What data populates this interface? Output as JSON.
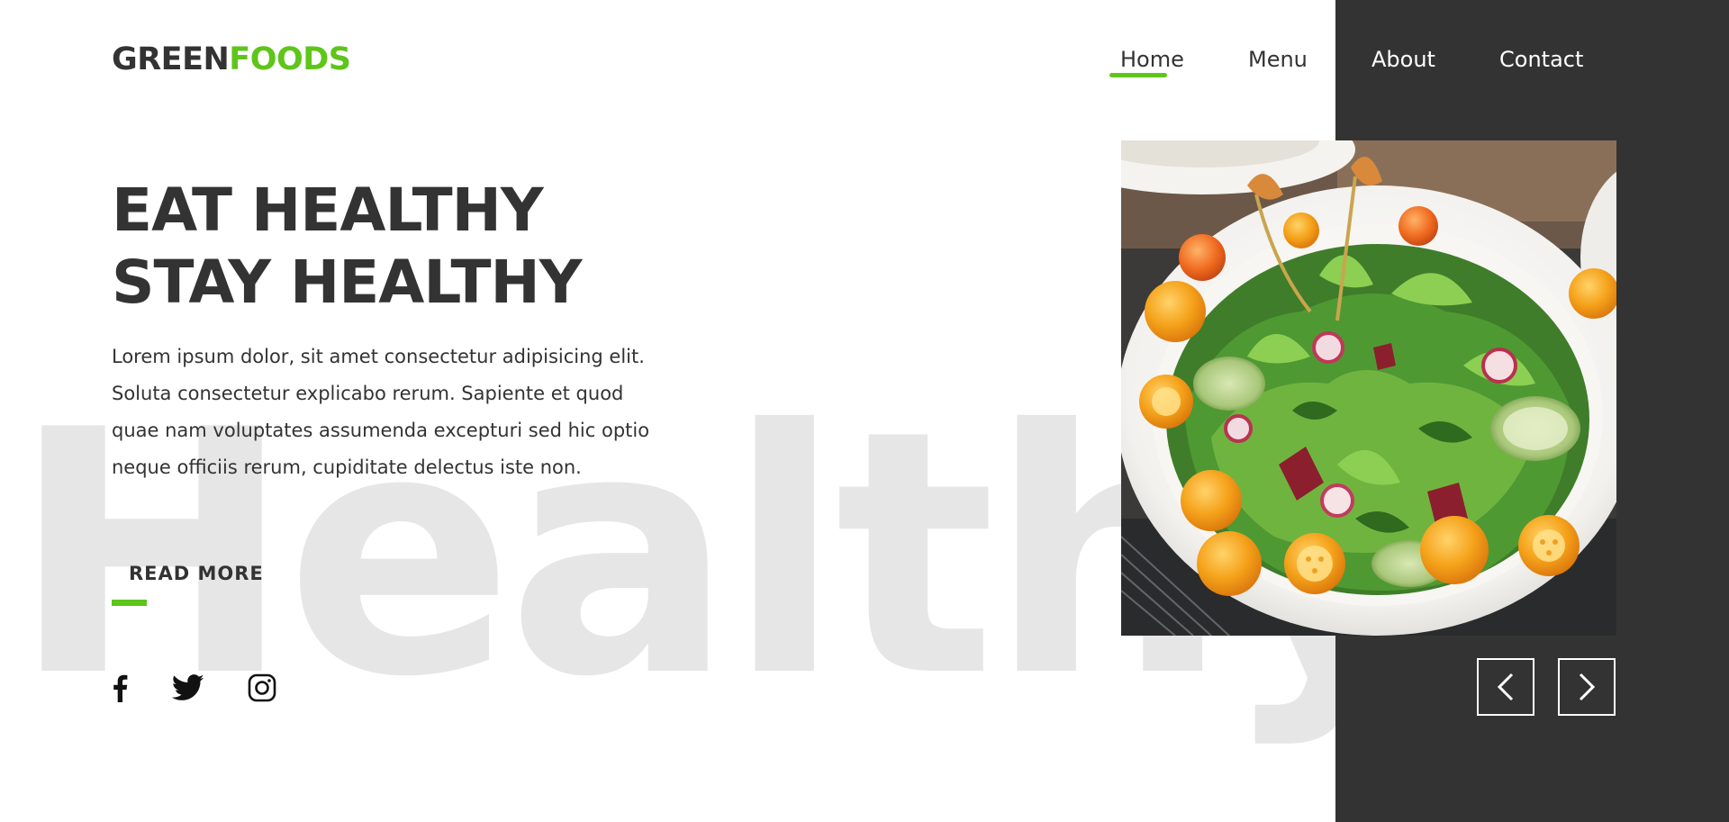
{
  "brand": {
    "name_dark": "GREEN",
    "name_green": "FOODS"
  },
  "nav": {
    "items": [
      {
        "label": "Home",
        "active": true
      },
      {
        "label": "Menu",
        "active": false
      },
      {
        "label": "About",
        "active": false
      },
      {
        "label": "Contact",
        "active": false
      }
    ]
  },
  "hero": {
    "headline_line1": "EAT HEALTHY",
    "headline_line2": "STAY HEALTHY",
    "body": "Lorem ipsum dolor, sit amet consectetur adipisicing elit. Soluta consectetur explicabo rerum. Sapiente et quod quae nam voluptates assumenda excepturi sed hic optio neque officiis rerum, cupiditate delectus iste non.",
    "cta_label": "READ MORE",
    "background_word": "Healthy",
    "image_icon": "salad-bowl-photo"
  },
  "social": {
    "icons": [
      "facebook-icon",
      "twitter-icon",
      "instagram-icon"
    ]
  },
  "slider": {
    "prev_icon": "chevron-left-icon",
    "next_icon": "chevron-right-icon"
  },
  "colors": {
    "accent": "#5ec51a",
    "dark": "#333333",
    "watermark": "#e6e6e6",
    "background": "#ffffff"
  }
}
